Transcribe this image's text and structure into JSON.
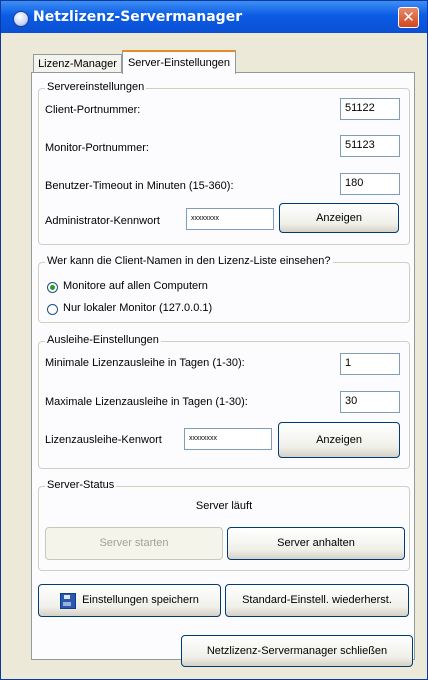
{
  "window": {
    "title": "Netzlizenz-Servermanager",
    "close_glyph": "✕",
    "icon": "app-icon"
  },
  "tabs": [
    {
      "label": "Lizenz-Manager",
      "selected": false
    },
    {
      "label": "Server-Einstellungen",
      "selected": true
    }
  ],
  "server_settings": {
    "legend": "Servereinstellungen",
    "client_port_label": "Client-Portnummer:",
    "client_port_value": "51122",
    "monitor_port_label": "Monitor-Portnummer:",
    "monitor_port_value": "51123",
    "timeout_label": "Benutzer-Timeout in Minuten (15-360):",
    "timeout_value": "180",
    "admin_password_label": "Administrator-Kennwort",
    "admin_password_value": "xxxxxxxx",
    "show_button": "Anzeigen"
  },
  "client_names": {
    "legend": "Wer kann die Client-Namen in den Lizenz-Liste einsehen?",
    "options": [
      {
        "label": "Monitore auf allen Computern",
        "selected": true
      },
      {
        "label": "Nur lokaler Monitor (127.0.0.1)",
        "selected": false
      }
    ]
  },
  "loan_settings": {
    "legend": "Ausleihe-Einstellungen",
    "min_label": "Minimale Lizenzausleihe in Tagen (1-30):",
    "min_value": "1",
    "max_label": "Maximale Lizenzausleihe in Tagen (1-30):",
    "max_value": "30",
    "password_label": "Lizenzausleihe-Kenwort",
    "password_value": "xxxxxxxx",
    "show_button": "Anzeigen"
  },
  "server_status": {
    "legend": "Server-Status",
    "status_text": "Server läuft",
    "start_button": "Server starten",
    "stop_button": "Server anhalten"
  },
  "actions": {
    "save_button": "Einstellungen speichern",
    "defaults_button": "Standard-Einstell. wiederherst.",
    "close_button": "Netzlizenz-Servermanager schließen"
  },
  "colors": {
    "titlebar": "#0b5ce5",
    "accent_tab": "#e68b2c",
    "radio_dot": "#21a121"
  }
}
